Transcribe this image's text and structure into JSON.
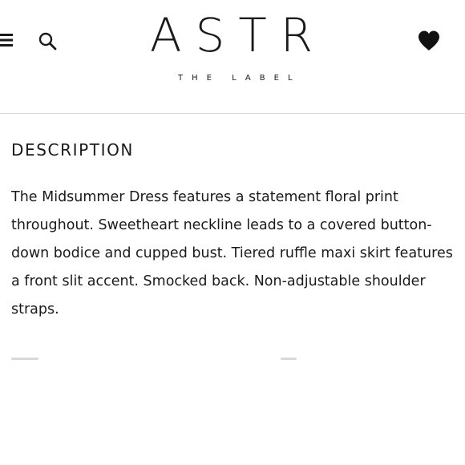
{
  "header": {
    "logo_text": "ASTR",
    "tagline": "THE LABEL",
    "icons": [
      "menu-icon",
      "search-icon",
      "heart-icon"
    ]
  },
  "main": {
    "section_title": "DESCRIPTION",
    "description": "The Midsummer Dress features a statement floral print throughout. Sweetheart neckline leads to a covered button-down bodice and cupped bust. Tiered ruffle maxi skirt features a front slit accent. Smocked back. Non-adjustable shoulder straps."
  }
}
